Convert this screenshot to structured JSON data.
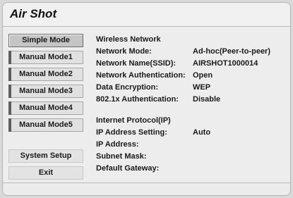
{
  "app": {
    "title": "Air Shot"
  },
  "sidebar": {
    "modes": [
      {
        "label": "Simple Mode",
        "selected": true
      },
      {
        "label": "Manual Mode1",
        "selected": false
      },
      {
        "label": "Manual Mode2",
        "selected": false
      },
      {
        "label": "Manual Mode3",
        "selected": false
      },
      {
        "label": "Manual Mode4",
        "selected": false
      },
      {
        "label": "Manual Mode5",
        "selected": false
      }
    ],
    "system_setup_label": "System Setup",
    "exit_label": "Exit"
  },
  "wireless": {
    "heading": "Wireless Network",
    "rows": [
      {
        "label": "Network Mode:",
        "value": "Ad-hoc(Peer-to-peer)"
      },
      {
        "label": "Network Name(SSID):",
        "value": "AIRSHOT1000014"
      },
      {
        "label": "Network Authentication:",
        "value": "Open"
      },
      {
        "label": "Data Encryption:",
        "value": "WEP"
      },
      {
        "label": "802.1x Authentication:",
        "value": "Disable"
      }
    ]
  },
  "ip": {
    "heading": "Internet Protocol(IP)",
    "rows": [
      {
        "label": "IP Address Setting:",
        "value": "Auto"
      },
      {
        "label": "IP Address:",
        "value": ""
      },
      {
        "label": "Subnet Mask:",
        "value": ""
      },
      {
        "label": "Default Gateway:",
        "value": ""
      }
    ]
  },
  "colors": {
    "background": "#ededed",
    "selected_button": "#c5c5c5",
    "button": "#e1e1e1",
    "accent_edge": "#5e5e5e"
  }
}
